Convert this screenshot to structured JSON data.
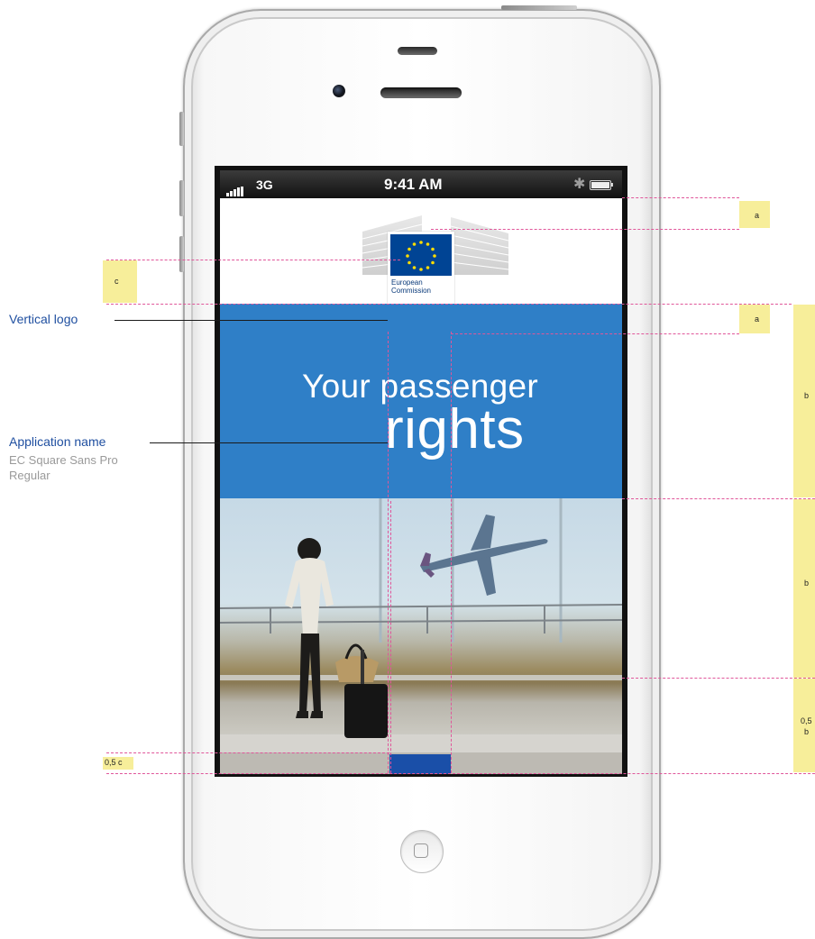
{
  "status_bar": {
    "network": "3G",
    "time": "9:41 AM"
  },
  "logo": {
    "line1": "European",
    "line2": "Commission"
  },
  "app_title": {
    "line1": "Your passenger",
    "line2": "rights"
  },
  "callouts": {
    "vertical_logo": "Vertical logo",
    "application_name": "Application name",
    "font_line1": "EC Square Sans Pro",
    "font_line2": "Regular"
  },
  "measure_tags": {
    "a_top": "a",
    "a_mid": "a",
    "c_left": "c",
    "b_title": "b",
    "b_photo": "b",
    "half_b_line1": "0,5",
    "half_b_line2": "b",
    "half_c": "0,5 c"
  },
  "colors": {
    "band_blue": "#2f7fc7",
    "flag_blue": "#004494",
    "annotation_pink": "#e0569a",
    "tag_yellow": "#f7ee9a"
  },
  "icons": [
    "signal-icon",
    "bluetooth-icon",
    "battery-icon",
    "eu-flag-icon",
    "airplane-icon"
  ]
}
